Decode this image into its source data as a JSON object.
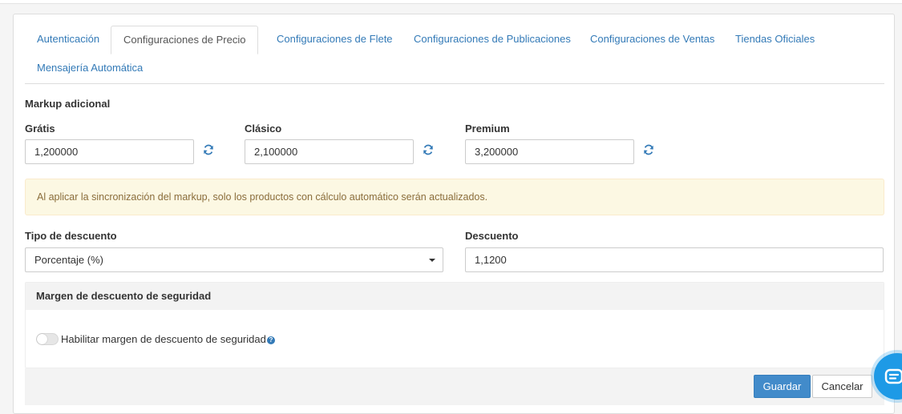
{
  "tabs": [
    {
      "label": "Autenticación",
      "active": false
    },
    {
      "label": "Configuraciones de Precio",
      "active": true
    },
    {
      "label": "Configuraciones de Flete",
      "active": false
    },
    {
      "label": "Configuraciones de Publicaciones",
      "active": false
    },
    {
      "label": "Configuraciones de Ventas",
      "active": false
    },
    {
      "label": "Tiendas Oficiales",
      "active": false
    },
    {
      "label": "Mensajería Automática",
      "active": false
    }
  ],
  "markup": {
    "title": "Markup adicional",
    "fields": [
      {
        "label": "Grátis",
        "value": "1,200000",
        "icon": "sync-icon"
      },
      {
        "label": "Clásico",
        "value": "2,100000",
        "icon": "sync-icon"
      },
      {
        "label": "Premium",
        "value": "3,200000",
        "icon": "sync-icon"
      }
    ]
  },
  "alert": {
    "text": "Al aplicar la sincronización del markup, solo los productos con cálculo automático serán actualizados."
  },
  "discount": {
    "type_label": "Tipo de descuento",
    "type_value": "Porcentaje (%)",
    "value_label": "Descuento",
    "value": "1,1200"
  },
  "safety_margin": {
    "title": "Margen de descuento de seguridad",
    "toggle_label": "Habilitar margen de descuento de seguridad",
    "enabled": false,
    "help_icon": "help-icon"
  },
  "actions": {
    "save_label": "Guardar",
    "cancel_label": "Cancelar"
  },
  "colors": {
    "link": "#337ab7",
    "primary": "#428bca",
    "alert_bg": "#fcf8e3",
    "alert_text": "#8a6d3b",
    "chat": "#1e9ae6"
  }
}
